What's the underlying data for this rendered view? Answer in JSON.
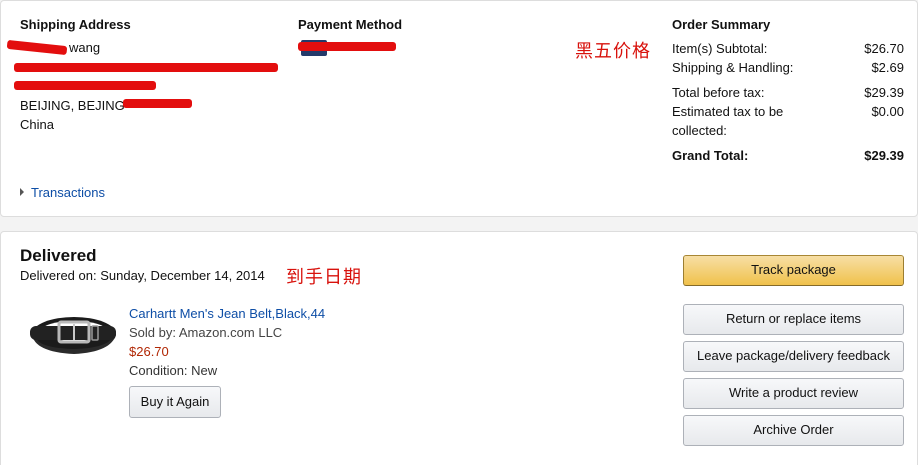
{
  "shipping": {
    "heading": "Shipping Address",
    "name_visible": "wang",
    "city_line": "BEIJING, BEJING",
    "country": "China"
  },
  "payment": {
    "heading": "Payment Method"
  },
  "annotation_price": "黑五价格",
  "annotation_date": "到手日期",
  "summary": {
    "heading": "Order Summary",
    "rows": [
      {
        "label": "Item(s) Subtotal:",
        "value": "$26.70"
      },
      {
        "label": "Shipping & Handling:",
        "value": "$2.69"
      },
      {
        "label": "Total before tax:",
        "value": "$29.39"
      },
      {
        "label": "Estimated tax to be",
        "label2": "collected:",
        "value": "$0.00"
      }
    ],
    "grand_label": "Grand Total:",
    "grand_value": "$29.39"
  },
  "transactions_label": "Transactions",
  "delivery": {
    "status": "Delivered",
    "date_text": "Delivered on: Sunday, December 14, 2014"
  },
  "item": {
    "title": "Carhartt Men's Jean Belt,Black,44",
    "seller": "Sold by: Amazon.com LLC",
    "price": "$26.70",
    "condition": "Condition: New",
    "buy_again_label": "Buy it Again"
  },
  "actions": {
    "track": "Track package",
    "return": "Return or replace items",
    "feedback": "Leave package/delivery feedback",
    "review": "Write a product review",
    "archive": "Archive Order"
  },
  "colors": {
    "link": "#0e4ea6",
    "price": "#b12704",
    "annotation": "#d8120c",
    "track_button": "#f0c14b"
  }
}
